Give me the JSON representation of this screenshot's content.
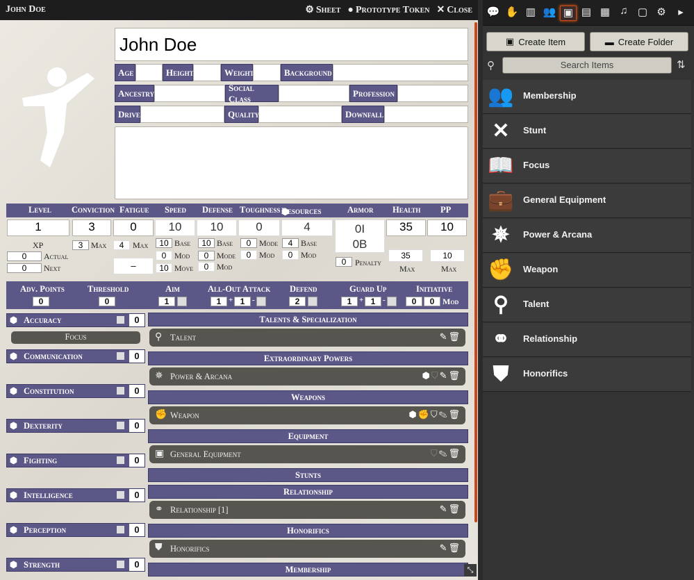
{
  "window": {
    "title": "John Doe",
    "actions": {
      "sheet": "Sheet",
      "token": "Prototype Token",
      "close": "Close"
    }
  },
  "character": {
    "name": "John Doe",
    "fields": {
      "age": "Age",
      "height": "Height",
      "weight": "Weight",
      "background": "Background",
      "ancestry": "Ancestry",
      "social_class": "Social Class",
      "profession": "Profession",
      "drive": "Drive",
      "quality": "Quality",
      "downfall": "Downfall"
    }
  },
  "stats": {
    "headers": {
      "level": "Level",
      "conviction": "Conviction",
      "fatigue": "Fatigue",
      "speed": "Speed",
      "defense": "Defense",
      "toughness": "Toughness",
      "resources": "Resources",
      "armor": "Armor",
      "health": "Health",
      "pp": "PP"
    },
    "level": "1",
    "conviction": "3",
    "fatigue": "0",
    "speed": "10",
    "defense": "10",
    "toughness": "0",
    "resources": "4",
    "armor_top": "0I",
    "armor_bottom": "0B",
    "health": "35",
    "pp": "10",
    "xp_label": "XP",
    "xp_actual": "0",
    "xp_actual_label": "Actual",
    "xp_next": "0",
    "xp_next_label": "Next",
    "conviction_max": "3",
    "max_label": "Max",
    "fatigue_max": "4",
    "fatigue_dash": "–",
    "speed_base": "10",
    "base_label": "Base",
    "speed_mod": "0",
    "mod_label": "Mod",
    "speed_move": "10",
    "move_label": "Move",
    "defense_base": "10",
    "defense_mode": "0",
    "mode_label": "Mode",
    "defense_mod": "0",
    "toughness_mode": "0",
    "toughness_mod": "0",
    "resources_base": "4",
    "resources_mod": "0",
    "armor_penalty": "0",
    "penalty_label": "Penalty",
    "health_max": "35",
    "pp_max": "10"
  },
  "combat": {
    "adv_points_label": "Adv. Points",
    "adv_points": "0",
    "threshold_label": "Threshold",
    "threshold": "0",
    "aim_label": "Aim",
    "aim": "1",
    "allout_label": "All-Out Attack",
    "allout_a": "1",
    "allout_b": "1",
    "plus": "+",
    "minus": "-",
    "defend_label": "Defend",
    "defend": "2",
    "guardup_label": "Guard Up",
    "guardup_a": "1",
    "guardup_b": "1",
    "initiative_label": "Initiative",
    "initiative_a": "0",
    "initiative_b": "0",
    "initiative_mod": "Mod"
  },
  "abilities": [
    {
      "name": "Accuracy",
      "value": "0"
    },
    {
      "name": "Communication",
      "value": "0"
    },
    {
      "name": "Constitution",
      "value": "0"
    },
    {
      "name": "Dexterity",
      "value": "0"
    },
    {
      "name": "Fighting",
      "value": "0"
    },
    {
      "name": "Intelligence",
      "value": "0"
    },
    {
      "name": "Perception",
      "value": "0"
    },
    {
      "name": "Strength",
      "value": "0"
    }
  ],
  "focus_button": "Focus",
  "sections": {
    "talents": "Talents & Specialization",
    "talent_item": "Talent",
    "powers": "Extraordinary Powers",
    "power_item": "Power & Arcana",
    "weapons": "Weapons",
    "weapon_item": "Weapon",
    "equipment": "Equipment",
    "equipment_item": "General Equipment",
    "stunts": "Stunts",
    "relationship": "Relationship",
    "relationship_item": "Relationship [1]",
    "honorifics": "Honorifics",
    "honorifics_item": "Honorifics",
    "membership": "Membership"
  },
  "sidebar": {
    "create_item": "Create Item",
    "create_folder": "Create Folder",
    "search_placeholder": "Search Items",
    "folders": [
      {
        "name": "Membership",
        "icon": "group-icon"
      },
      {
        "name": "Stunt",
        "icon": "crossed-swords-icon"
      },
      {
        "name": "Focus",
        "icon": "open-book-icon"
      },
      {
        "name": "General Equipment",
        "icon": "briefcase-icon"
      },
      {
        "name": "Power & Arcana",
        "icon": "radiant-figure-icon"
      },
      {
        "name": "Weapon",
        "icon": "fist-icon"
      },
      {
        "name": "Talent",
        "icon": "skill-tree-icon"
      },
      {
        "name": "Relationship",
        "icon": "pair-icon"
      },
      {
        "name": "Honorifics",
        "icon": "rank-badge-icon"
      }
    ]
  },
  "colors": {
    "accent": "#5b5787",
    "highlight": "#c9471c"
  }
}
